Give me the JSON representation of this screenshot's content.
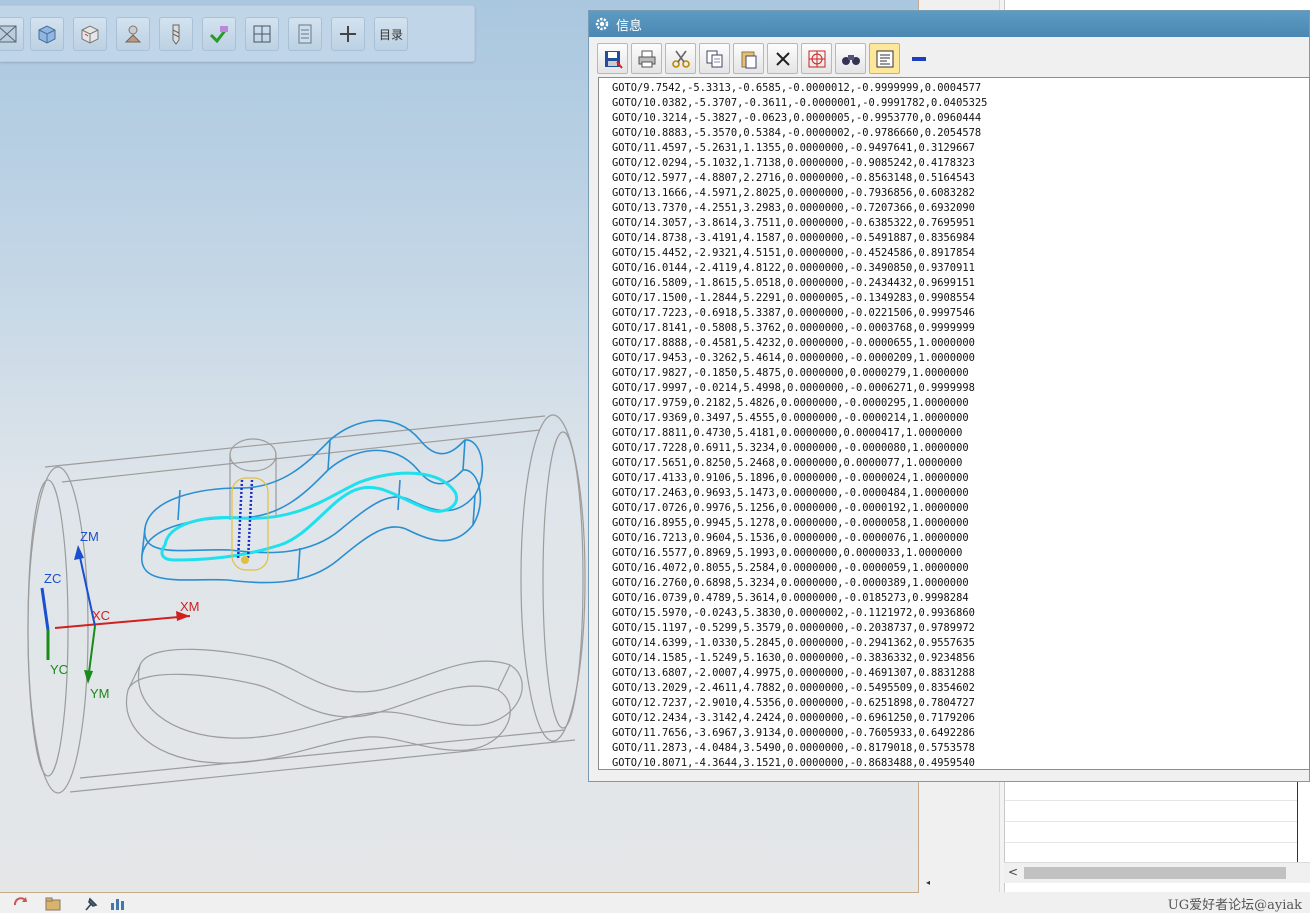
{
  "toolbar": {
    "buttons": [
      "view-section",
      "view-cube-shaded",
      "view-cube-wire",
      "view-model",
      "view-tool",
      "verify",
      "view-grid",
      "view-list",
      "add"
    ],
    "catalog_label": "目录"
  },
  "dialog": {
    "title": "信息",
    "tools": [
      "save",
      "print",
      "cut",
      "copy",
      "paste",
      "delete",
      "find-target",
      "find",
      "wrap-text",
      "minimize"
    ],
    "lines": [
      "GOTO/9.7542,-5.3313,-0.6585,-0.0000012,-0.9999999,0.0004577",
      "GOTO/10.0382,-5.3707,-0.3611,-0.0000001,-0.9991782,0.0405325",
      "GOTO/10.3214,-5.3827,-0.0623,0.0000005,-0.9953770,0.0960444",
      "GOTO/10.8883,-5.3570,0.5384,-0.0000002,-0.9786660,0.2054578",
      "GOTO/11.4597,-5.2631,1.1355,0.0000000,-0.9497641,0.3129667",
      "GOTO/12.0294,-5.1032,1.7138,0.0000000,-0.9085242,0.4178323",
      "GOTO/12.5977,-4.8807,2.2716,0.0000000,-0.8563148,0.5164543",
      "GOTO/13.1666,-4.5971,2.8025,0.0000000,-0.7936856,0.6083282",
      "GOTO/13.7370,-4.2551,3.2983,0.0000000,-0.7207366,0.6932090",
      "GOTO/14.3057,-3.8614,3.7511,0.0000000,-0.6385322,0.7695951",
      "GOTO/14.8738,-3.4191,4.1587,0.0000000,-0.5491887,0.8356984",
      "GOTO/15.4452,-2.9321,4.5151,0.0000000,-0.4524586,0.8917854",
      "GOTO/16.0144,-2.4119,4.8122,0.0000000,-0.3490850,0.9370911",
      "GOTO/16.5809,-1.8615,5.0518,0.0000000,-0.2434432,0.9699151",
      "GOTO/17.1500,-1.2844,5.2291,0.0000005,-0.1349283,0.9908554",
      "GOTO/17.7223,-0.6918,5.3387,0.0000000,-0.0221506,0.9997546",
      "GOTO/17.8141,-0.5808,5.3762,0.0000000,-0.0003768,0.9999999",
      "GOTO/17.8888,-0.4581,5.4232,0.0000000,-0.0000655,1.0000000",
      "GOTO/17.9453,-0.3262,5.4614,0.0000000,-0.0000209,1.0000000",
      "GOTO/17.9827,-0.1850,5.4875,0.0000000,0.0000279,1.0000000",
      "GOTO/17.9997,-0.0214,5.4998,0.0000000,-0.0006271,0.9999998",
      "GOTO/17.9759,0.2182,5.4826,0.0000000,-0.0000295,1.0000000",
      "GOTO/17.9369,0.3497,5.4555,0.0000000,-0.0000214,1.0000000",
      "GOTO/17.8811,0.4730,5.4181,0.0000000,0.0000417,1.0000000",
      "GOTO/17.7228,0.6911,5.3234,0.0000000,-0.0000080,1.0000000",
      "GOTO/17.5651,0.8250,5.2468,0.0000000,0.0000077,1.0000000",
      "GOTO/17.4133,0.9106,5.1896,0.0000000,-0.0000024,1.0000000",
      "GOTO/17.2463,0.9693,5.1473,0.0000000,-0.0000484,1.0000000",
      "GOTO/17.0726,0.9976,5.1256,0.0000000,-0.0000192,1.0000000",
      "GOTO/16.8955,0.9945,5.1278,0.0000000,-0.0000058,1.0000000",
      "GOTO/16.7213,0.9604,5.1536,0.0000000,-0.0000076,1.0000000",
      "GOTO/16.5577,0.8969,5.1993,0.0000000,0.0000033,1.0000000",
      "GOTO/16.4072,0.8055,5.2584,0.0000000,-0.0000059,1.0000000",
      "GOTO/16.2760,0.6898,5.3234,0.0000000,-0.0000389,1.0000000",
      "GOTO/16.0739,0.4789,5.3614,0.0000000,-0.0185273,0.9998284",
      "GOTO/15.5970,-0.0243,5.3830,0.0000002,-0.1121972,0.9936860",
      "GOTO/15.1197,-0.5299,5.3579,0.0000000,-0.2038737,0.9789972",
      "GOTO/14.6399,-1.0330,5.2845,0.0000000,-0.2941362,0.9557635",
      "GOTO/14.1585,-1.5249,5.1630,0.0000000,-0.3836332,0.9234856",
      "GOTO/13.6807,-2.0007,4.9975,0.0000000,-0.4691307,0.8831288",
      "GOTO/13.2029,-2.4611,4.7882,0.0000000,-0.5495509,0.8354602",
      "GOTO/12.7237,-2.9010,4.5356,0.0000000,-0.6251898,0.7804727",
      "GOTO/12.2434,-3.3142,4.2424,0.0000000,-0.6961250,0.7179206",
      "GOTO/11.7656,-3.6967,3.9134,0.0000000,-0.7605933,0.6492286",
      "GOTO/11.2873,-4.0484,3.5490,0.0000000,-0.8179018,0.5753578",
      "GOTO/10.8071,-4.3644,3.1521,0.0000000,-0.8683488,0.4959540"
    ]
  },
  "axes": {
    "zm": "ZM",
    "zc": "ZC",
    "xc": "XC",
    "xm": "XM",
    "yc": "YC",
    "ym": "YM"
  },
  "colors": {
    "toolpath": "#1fe0ee",
    "part_edges": "#2a8fd0",
    "title_bar": "#4a88b3",
    "axis_x": "#d02020",
    "axis_y": "#1a8a1a",
    "axis_z": "#1a4fd0"
  },
  "watermark": "UG爱好者论坛@ayiak"
}
